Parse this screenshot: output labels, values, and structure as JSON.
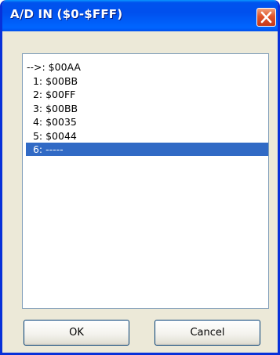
{
  "window": {
    "title": "A/D IN ($0-$FFF)"
  },
  "list": {
    "items": [
      "-->: $00AA",
      "  1: $00BB",
      "  2: $00FF",
      "  3: $00BB",
      "  4: $0035",
      "  5: $0044",
      "  6: -----"
    ],
    "selected_index": 6
  },
  "buttons": {
    "ok_label": "OK",
    "cancel_label": "Cancel"
  },
  "icons": {
    "close": "close-icon"
  },
  "colors": {
    "titlebar": "#0053ee",
    "frame": "#0831d9",
    "dialog_background": "#ece9d8",
    "selection": "#316ac5",
    "close_button": "#e0542a"
  }
}
